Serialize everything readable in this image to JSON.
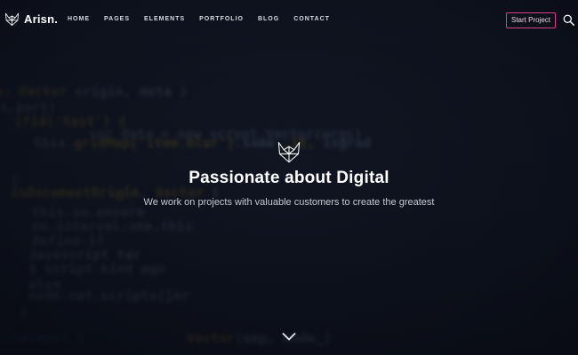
{
  "brand": {
    "name": "Arisn.",
    "logo_icon": "fox-head-icon"
  },
  "nav": {
    "items": [
      {
        "label": "HOME"
      },
      {
        "label": "PAGES"
      },
      {
        "label": "ELEMENTS"
      },
      {
        "label": "PORTFOLIO"
      },
      {
        "label": "BLOG"
      },
      {
        "label": "CONTACT"
      }
    ],
    "cta_label": "Start Project",
    "cta_color": "#d9408a",
    "search_icon": "search-icon"
  },
  "hero": {
    "icon": "fox-head-icon",
    "title": "Passionate about Digital",
    "subtitle": "We work on projects with valuable customers to create the greatest",
    "scroll_icon": "chevron-down-icon"
  },
  "background": {
    "code_lines": [
      "9(),",
      "e: Vector  origin, meta )",
      "s.port)",
      "ifid('test') {",
      "var data = new scrypt.Vector(args)",
      "this.gridMap['item.blur'].some ,it, isgrad",
      "{",
      "isDocumentOrigin.  Vector (",
      "this.in.ensure",
      "on.interval.one,this",
      "define.if",
      "Javascript tar",
      "$ script.kind ago",
      "else",
      "node.set.scripts(jnr",
      "}",
      "nstainer( {",
      "Vector(map, mode_)"
    ]
  }
}
